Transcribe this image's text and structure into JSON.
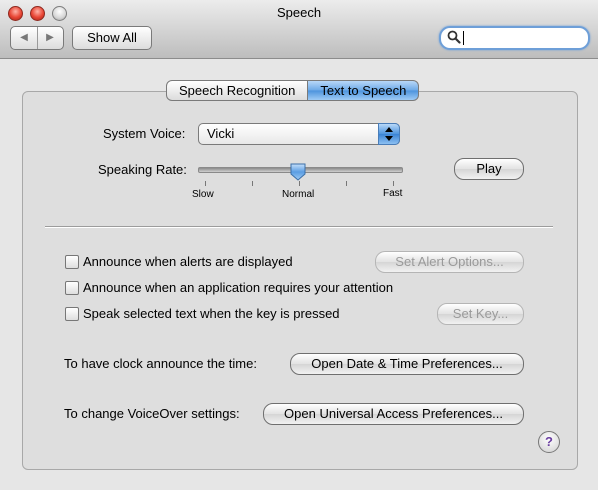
{
  "window": {
    "title": "Speech"
  },
  "toolbar": {
    "back_icon": "◀",
    "forward_icon": "▶",
    "show_all_label": "Show All",
    "search": {
      "value": "",
      "placeholder": ""
    }
  },
  "tabs": [
    {
      "label": "Speech Recognition",
      "selected": false
    },
    {
      "label": "Text to Speech",
      "selected": true
    }
  ],
  "voice": {
    "label": "System Voice:",
    "value": "Vicki"
  },
  "rate": {
    "label": "Speaking Rate:",
    "slow": "Slow",
    "normal": "Normal",
    "fast": "Fast",
    "level": 0.5,
    "play_label": "Play"
  },
  "options": [
    {
      "label": "Announce when alerts are displayed",
      "checked": false,
      "button": "Set Alert Options..."
    },
    {
      "label": "Announce when an application requires your attention",
      "checked": false
    },
    {
      "label": "Speak selected text when the key is pressed",
      "checked": false,
      "button": "Set Key..."
    }
  ],
  "clock": {
    "label": "To have clock announce the time:",
    "button": "Open Date & Time Preferences..."
  },
  "voiceover": {
    "label": "To change VoiceOver settings:",
    "button": "Open Universal Access Preferences..."
  },
  "help": {
    "label": "?"
  },
  "colors": {
    "tab_selected": "#6ba8e6",
    "help_glyph": "#6a3ea1"
  }
}
